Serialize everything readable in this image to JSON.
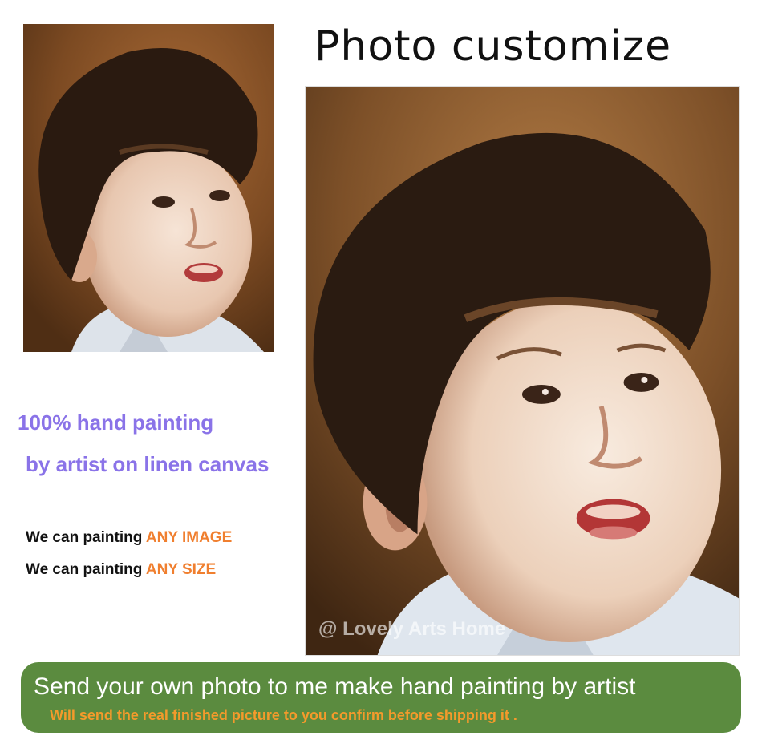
{
  "header": {
    "title": "Photo customize"
  },
  "portraits": {
    "watermark": "@ Lovely Arts Home"
  },
  "claims": {
    "line1": "100% hand painting",
    "line2": "by artist on linen canvas"
  },
  "features": [
    {
      "prefix": "We can painting ",
      "highlight": "ANY IMAGE"
    },
    {
      "prefix": "We can painting ",
      "highlight": "ANY SIZE"
    }
  ],
  "banner": {
    "main": "Send your own photo to me make hand painting by artist",
    "sub": "Will send the real finished picture to you confirm before shipping it ."
  },
  "colors": {
    "claim_text": "#8a73e8",
    "highlight": "#f07f2f",
    "banner_bg": "#5b8b3f",
    "banner_sub": "#f49a2b"
  }
}
